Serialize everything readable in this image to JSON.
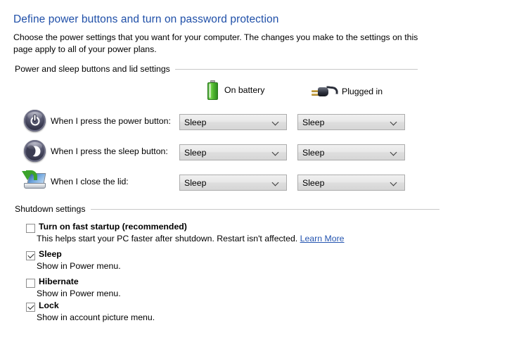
{
  "header": {
    "title": "Define power buttons and turn on password protection",
    "description": "Choose the power settings that you want for your computer. The changes you make to the settings on this page apply to all of your power plans."
  },
  "power_group": {
    "label": "Power and sleep buttons and lid settings",
    "columns": [
      {
        "icon": "battery-icon",
        "label": "On battery"
      },
      {
        "icon": "power-plug-icon",
        "label": "Plugged in"
      }
    ],
    "rows": [
      {
        "icon": "power-button-icon",
        "label": "When I press the power button:",
        "on_battery": "Sleep",
        "plugged_in": "Sleep"
      },
      {
        "icon": "sleep-button-icon",
        "label": "When I press the sleep button:",
        "on_battery": "Sleep",
        "plugged_in": "Sleep"
      },
      {
        "icon": "laptop-lid-icon",
        "label": "When I close the lid:",
        "on_battery": "Sleep",
        "plugged_in": "Sleep"
      }
    ]
  },
  "shutdown_group": {
    "label": "Shutdown settings",
    "items": [
      {
        "label": "Turn on fast startup (recommended)",
        "checked": false,
        "sub_text": "This helps start your PC faster after shutdown. Restart isn't affected.",
        "link_text": "Learn More"
      },
      {
        "label": "Sleep",
        "checked": true,
        "sub_text": "Show in Power menu.",
        "link_text": ""
      },
      {
        "label": "Hibernate",
        "checked": false,
        "sub_text": "Show in Power menu.",
        "link_text": ""
      },
      {
        "label": "Lock",
        "checked": true,
        "sub_text": "Show in account picture menu.",
        "link_text": ""
      }
    ]
  },
  "colors": {
    "title_blue": "#1f4fa8",
    "link_blue": "#2555b0",
    "rule_gray": "#c8c8c8",
    "battery_green": "#55bb32"
  }
}
